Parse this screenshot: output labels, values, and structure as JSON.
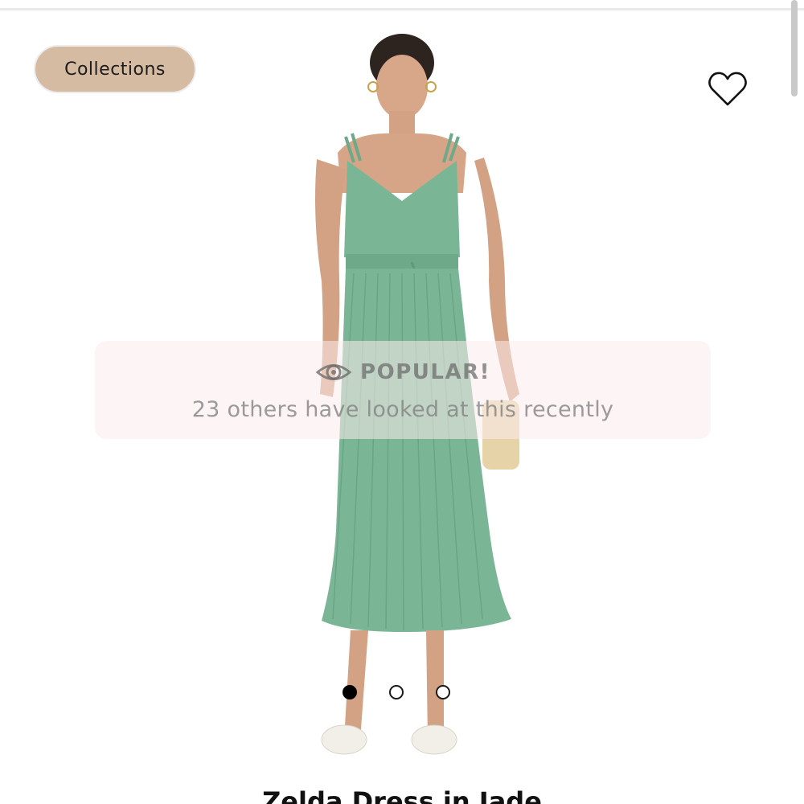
{
  "header": {
    "collections_label": "Collections"
  },
  "icons": {
    "wishlist": "heart-icon",
    "popular": "eye-icon"
  },
  "popular_notice": {
    "label": "POPULAR!",
    "message": "23 others have looked at this recently"
  },
  "carousel": {
    "total_slides": 3,
    "active_index": 0
  },
  "product": {
    "title": "Zelda Dress in Jade"
  },
  "colors": {
    "collections_bg": "#d6bba3",
    "dress": "#7ab596",
    "banner_bg": "#fcecec"
  }
}
